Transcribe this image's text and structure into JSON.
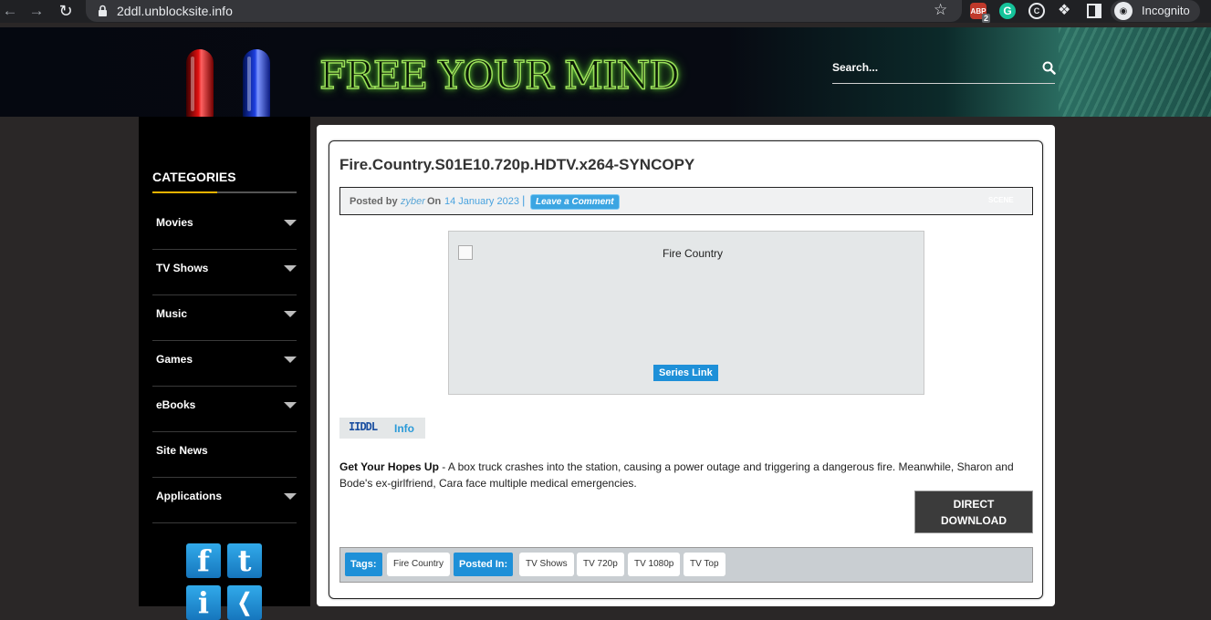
{
  "browser": {
    "url": "2ddl.unblocksite.info",
    "abp_badge": "2",
    "abp_label": "ABP",
    "incognito_label": "Incognito"
  },
  "header": {
    "logo_text": "FREE YOUR MIND",
    "search_placeholder": "Search..."
  },
  "sidebar": {
    "heading": "CATEGORIES",
    "items": [
      {
        "label": "Movies",
        "has_arrow": true
      },
      {
        "label": "TV Shows",
        "has_arrow": true
      },
      {
        "label": "Music",
        "has_arrow": true
      },
      {
        "label": "Games",
        "has_arrow": true
      },
      {
        "label": "eBooks",
        "has_arrow": true
      },
      {
        "label": "Site News",
        "has_arrow": false
      },
      {
        "label": "Applications",
        "has_arrow": true
      }
    ],
    "social": [
      {
        "icon": "facebook-icon",
        "glyph": "f"
      },
      {
        "icon": "twitter-icon",
        "glyph": "t"
      },
      {
        "icon": "info-icon",
        "glyph": "i"
      },
      {
        "icon": "rss-icon",
        "glyph": ")"
      }
    ]
  },
  "post": {
    "title": "Fire.Country.S01E10.720p.HDTV.x264-SYNCOPY",
    "meta": {
      "posted_by": "Posted by",
      "author": "zyber",
      "on": "On",
      "date": "14 January 2023",
      "separator": "|",
      "comment": "Leave a Comment",
      "category": "SCENE"
    },
    "image_alt": "Fire Country",
    "series_link": "Series Link",
    "info_logo": "IIDDL",
    "info_label": "Info",
    "episode_title": "Get Your Hopes Up",
    "synopsis": " - A box truck crashes into the station, causing a power outage and triggering a dangerous fire. Meanwhile, Sharon and Bode's ex-girlfriend, Cara face multiple medical emergencies.",
    "download": {
      "line1": "DIRECT",
      "line2": "DOWNLOAD"
    },
    "tags_label": "Tags:",
    "tags": [
      "Fire Country"
    ],
    "posted_in_label": "Posted In:",
    "posted_in": [
      "TV Shows",
      "TV 720p",
      "TV 1080p",
      "TV Top"
    ]
  },
  "colors": {
    "accent_blue": "#1e90d8",
    "category_underline": "#f0b400",
    "sidebar_bg": "#000000",
    "page_bg": "#2a2727"
  }
}
